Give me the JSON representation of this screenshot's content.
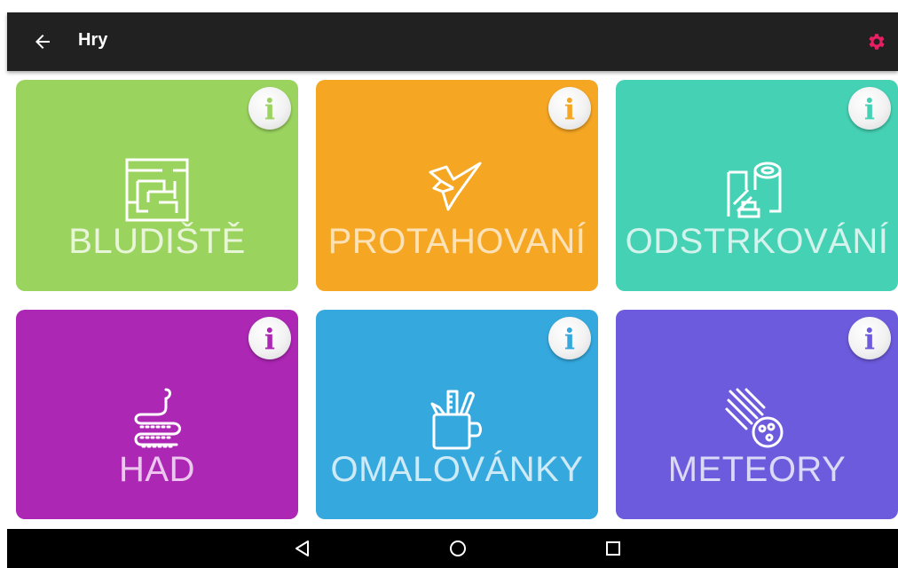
{
  "appbar": {
    "title": "Hry"
  },
  "colors": {
    "accent_gear": "#e91e63",
    "appbar_bg": "#212121"
  },
  "tiles": [
    {
      "label": "BLUDIŠTĚ",
      "bg": "#9bd35f",
      "fg": "#e8f5d8",
      "info_color": "#9bd35f",
      "icon": "maze-icon"
    },
    {
      "label": "PROTAHOVANÍ",
      "bg": "#f5a623",
      "fg": "#fde2b8",
      "info_color": "#f5a623",
      "icon": "origami-bird-icon"
    },
    {
      "label": "ODSTRKOVÁNÍ",
      "bg": "#45d1b4",
      "fg": "#d3f3ec",
      "info_color": "#45d1b4",
      "icon": "curling-push-icon"
    },
    {
      "label": "HAD",
      "bg": "#ad27b5",
      "fg": "#ecc6ef",
      "info_color": "#ad27b5",
      "icon": "snake-icon"
    },
    {
      "label": "OMALOVÁNKY",
      "bg": "#35a9de",
      "fg": "#cfeaf7",
      "info_color": "#35a9de",
      "icon": "pencil-cup-icon"
    },
    {
      "label": "METEORY",
      "bg": "#6c5bdc",
      "fg": "#dcd8f7",
      "info_color": "#6c5bdc",
      "icon": "meteor-icon"
    }
  ],
  "navbar": {
    "buttons": [
      "back-triangle-icon",
      "home-circle-icon",
      "recents-square-icon"
    ]
  }
}
